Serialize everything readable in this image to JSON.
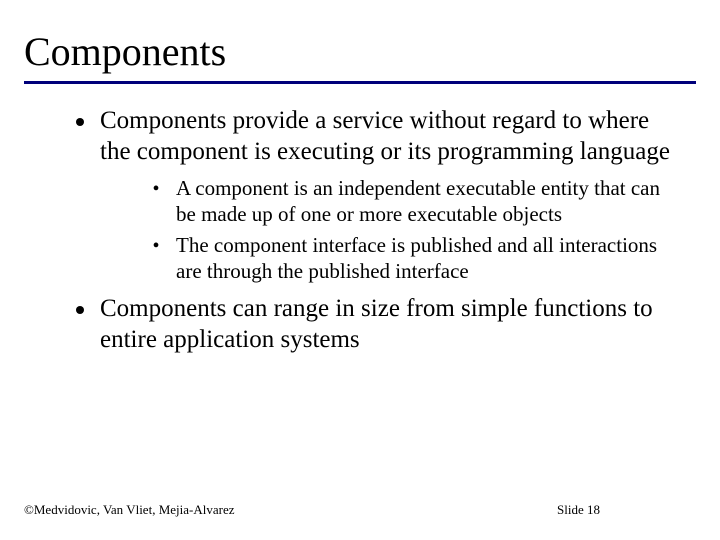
{
  "title": "Components",
  "bullets": [
    {
      "text": "Components provide a service without regard to where the component is executing or its programming language",
      "sub": [
        "A component is an independent executable entity that can be made up of one or more executable objects",
        "The component interface is published and all interactions are through the published interface"
      ]
    },
    {
      "text": "Components can range in size from simple functions to entire application systems",
      "sub": []
    }
  ],
  "footer": {
    "copyright": "©Medvidovic, Van Vliet, Mejia-Alvarez",
    "slide": "Slide 18"
  }
}
